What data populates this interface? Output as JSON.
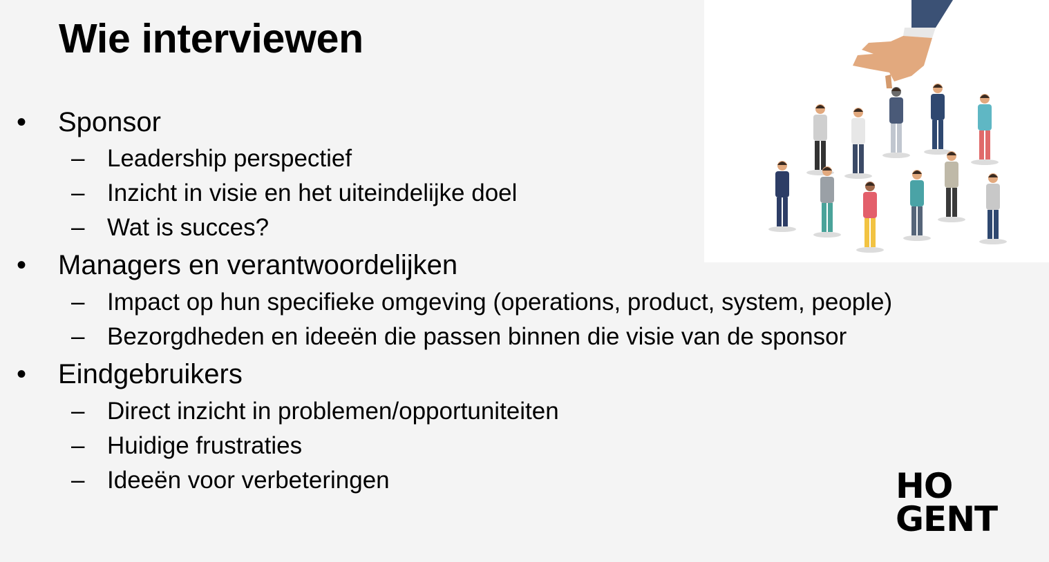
{
  "slide": {
    "title": "Wie interviewen",
    "sections": [
      {
        "heading": "Sponsor",
        "items": [
          "Leadership perspectief",
          "Inzicht in visie en het uiteindelijke doel",
          "Wat is succes?"
        ]
      },
      {
        "heading": "Managers en verantwoordelijken",
        "items": [
          "Impact op hun specifieke omgeving (operations, product, system, people)",
          "Bezorgdheden en ideeën die passen binnen die visie van de sponsor"
        ]
      },
      {
        "heading": "Eindgebruikers",
        "items": [
          "Direct inzicht in problemen/opportuniteiten",
          "Huidige frustraties",
          "Ideeën voor verbeteringen"
        ]
      }
    ],
    "bullet_symbol": "•",
    "dash_symbol": "–"
  },
  "logo": {
    "line1": "HO",
    "line2": "GENT"
  },
  "illustration": {
    "icon": "hand-picking-person-from-crowd-icon"
  }
}
